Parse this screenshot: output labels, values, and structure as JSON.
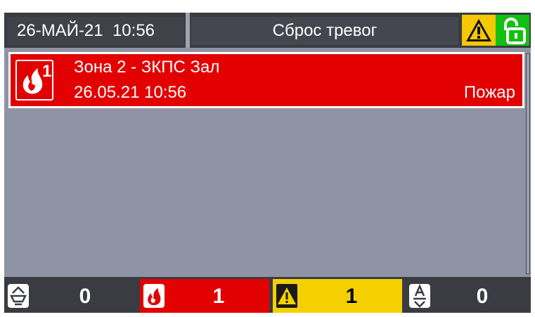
{
  "header": {
    "datetime": "26-МАЙ-21  10:56",
    "title": "Сброс тревог",
    "warning_icon": "warning-icon",
    "lock_icon": "unlock-icon"
  },
  "events": [
    {
      "icon": "fire-alarm-icon",
      "icon_badge": "1",
      "title": "Зона 2 - ЗКПС Зал",
      "time": "26.05.21 10:56",
      "type": "Пожар"
    }
  ],
  "counters": [
    {
      "icon": "detector-icon",
      "value": "0"
    },
    {
      "icon": "fire-icon",
      "value": "1"
    },
    {
      "icon": "warning-icon",
      "value": "1"
    },
    {
      "icon": "device-fault-icon",
      "value": "0"
    }
  ],
  "colors": {
    "alarm": "#e20000",
    "warning": "#f5d000",
    "ok": "#11c011",
    "background": "#8f93a3",
    "bar": "#3a3c42"
  }
}
